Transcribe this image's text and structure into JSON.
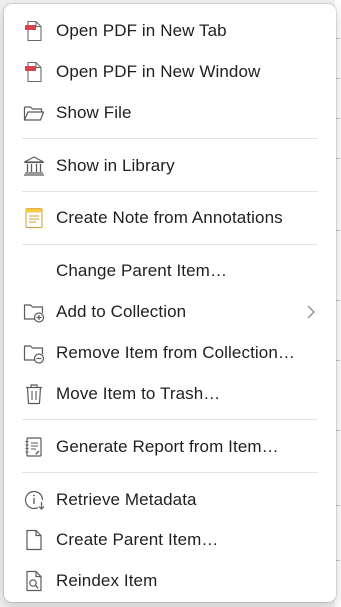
{
  "menu": {
    "items": [
      {
        "label": "Open PDF in New Tab",
        "icon": "pdf-file-icon"
      },
      {
        "label": "Open PDF in New Window",
        "icon": "pdf-file-icon"
      },
      {
        "label": "Show File",
        "icon": "folder-open-icon"
      },
      {
        "label": "Show in Library",
        "icon": "library-icon"
      },
      {
        "label": "Create Note from Annotations",
        "icon": "note-icon"
      },
      {
        "label": "Change Parent Item…",
        "icon": ""
      },
      {
        "label": "Add to Collection",
        "icon": "folder-add-icon",
        "has_submenu": true
      },
      {
        "label": "Remove Item from Collection…",
        "icon": "folder-remove-icon"
      },
      {
        "label": "Move Item to Trash…",
        "icon": "trash-icon"
      },
      {
        "label": "Generate Report from Item…",
        "icon": "report-icon"
      },
      {
        "label": "Retrieve Metadata",
        "icon": "retrieve-metadata-icon"
      },
      {
        "label": "Create Parent Item…",
        "icon": "document-icon"
      },
      {
        "label": "Reindex Item",
        "icon": "reindex-icon"
      }
    ]
  },
  "colors": {
    "pdf_red": "#d9424b",
    "note_yellow": "#f5c84a",
    "icon_gray": "#5a5a5a",
    "text": "#1f1f1f",
    "separator": "#e3e3e3"
  }
}
